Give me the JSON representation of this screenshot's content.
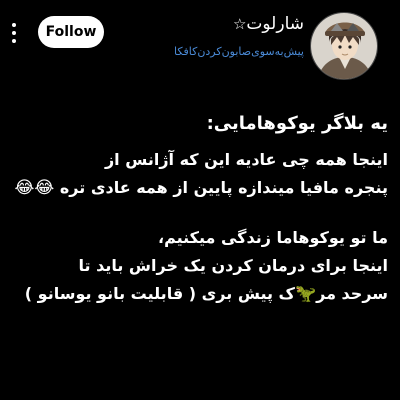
{
  "header": {
    "follow_label": "Follow",
    "username": "شارلوت",
    "username_symbol": "☆",
    "bio_link": "پیش‌به‌سوی‌صابون‌کردن‌کافکا"
  },
  "post": {
    "title": "یه بلاگر یوکوهامایی:",
    "paragraph1": [
      "اینجا همه چی عادیه این که آژانس از",
      "پنجره مافیا میندازه پایین از همه عادی تره"
    ],
    "paragraph1_emoji": "😂😂",
    "paragraph2": [
      "ما تو یوکوهاما زندگی میکنیم،",
      "اینجا برای درمان کردن یک خراش باید تا"
    ],
    "line_last_start": "سرحد مر",
    "line_last_emoji": "🦖",
    "line_last_end": "ک پیش بری ( قابلیت بانو یوسانو )"
  }
}
